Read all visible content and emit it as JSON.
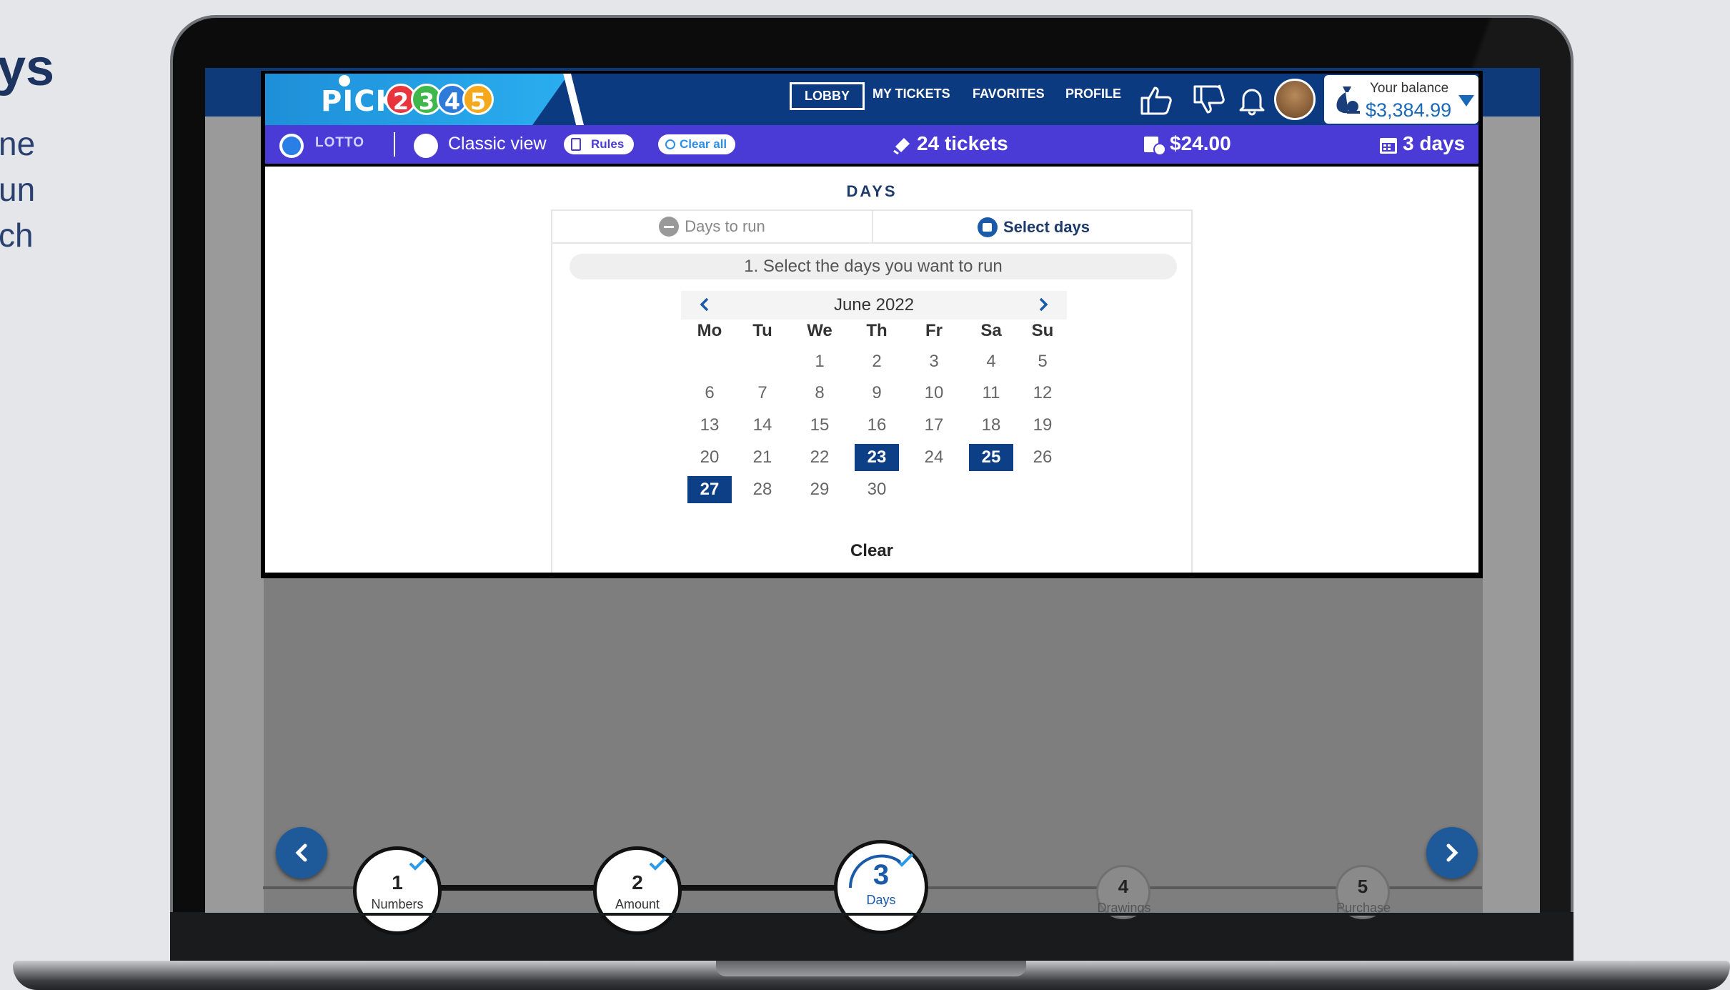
{
  "side_text": {
    "title": "ys",
    "lines": [
      "ne",
      "un",
      "ch"
    ]
  },
  "app": {
    "logo_text": "PICK",
    "logo_digits": [
      "2",
      "3",
      "4",
      "5"
    ],
    "nav": {
      "lobby": "LOBBY",
      "my_tickets": "MY TICKETS",
      "favorites": "FAVORITES",
      "profile": "PROFILE"
    },
    "balance": {
      "label": "Your balance",
      "value": "$3,384.99"
    },
    "subbar": {
      "lotto_label": "LOTTO",
      "classic_view": "Classic view",
      "rules": "Rules",
      "clear_all": "Clear all",
      "tickets": "24 tickets",
      "amount": "$24.00",
      "days": "3 days"
    }
  },
  "days_section": {
    "title": "DAYS",
    "tabs": [
      {
        "label": "Days to run",
        "active": false
      },
      {
        "label": "Select days",
        "active": true
      }
    ],
    "instruction": "1. Select the days you want to run",
    "calendar": {
      "month": "June 2022",
      "weekdays": [
        "Mo",
        "Tu",
        "We",
        "Th",
        "Fr",
        "Sa",
        "Su"
      ],
      "weeks": [
        [
          "",
          "",
          "1",
          "2",
          "3",
          "4",
          "5"
        ],
        [
          "6",
          "7",
          "8",
          "9",
          "10",
          "11",
          "12"
        ],
        [
          "13",
          "14",
          "15",
          "16",
          "17",
          "18",
          "19"
        ],
        [
          "20",
          "21",
          "22",
          "23",
          "24",
          "25",
          "26"
        ],
        [
          "27",
          "28",
          "29",
          "30",
          "",
          "",
          ""
        ]
      ],
      "selected": [
        "23",
        "25",
        "27"
      ]
    },
    "clear_label": "Clear"
  },
  "wizard": {
    "steps": [
      {
        "num": "1",
        "label": "Numbers",
        "done": true
      },
      {
        "num": "2",
        "label": "Amount",
        "done": true
      },
      {
        "num": "3",
        "label": "Days",
        "done": true,
        "current": true
      },
      {
        "num": "4",
        "label": "Drawings",
        "done": false
      },
      {
        "num": "5",
        "label": "Purchase",
        "done": false
      }
    ]
  },
  "colors": {
    "brand_navy": "#0b3a80",
    "subbar_purple": "#4a3bd6",
    "selected_day": "#0c3f86",
    "balance_blue": "#1a68b8"
  }
}
